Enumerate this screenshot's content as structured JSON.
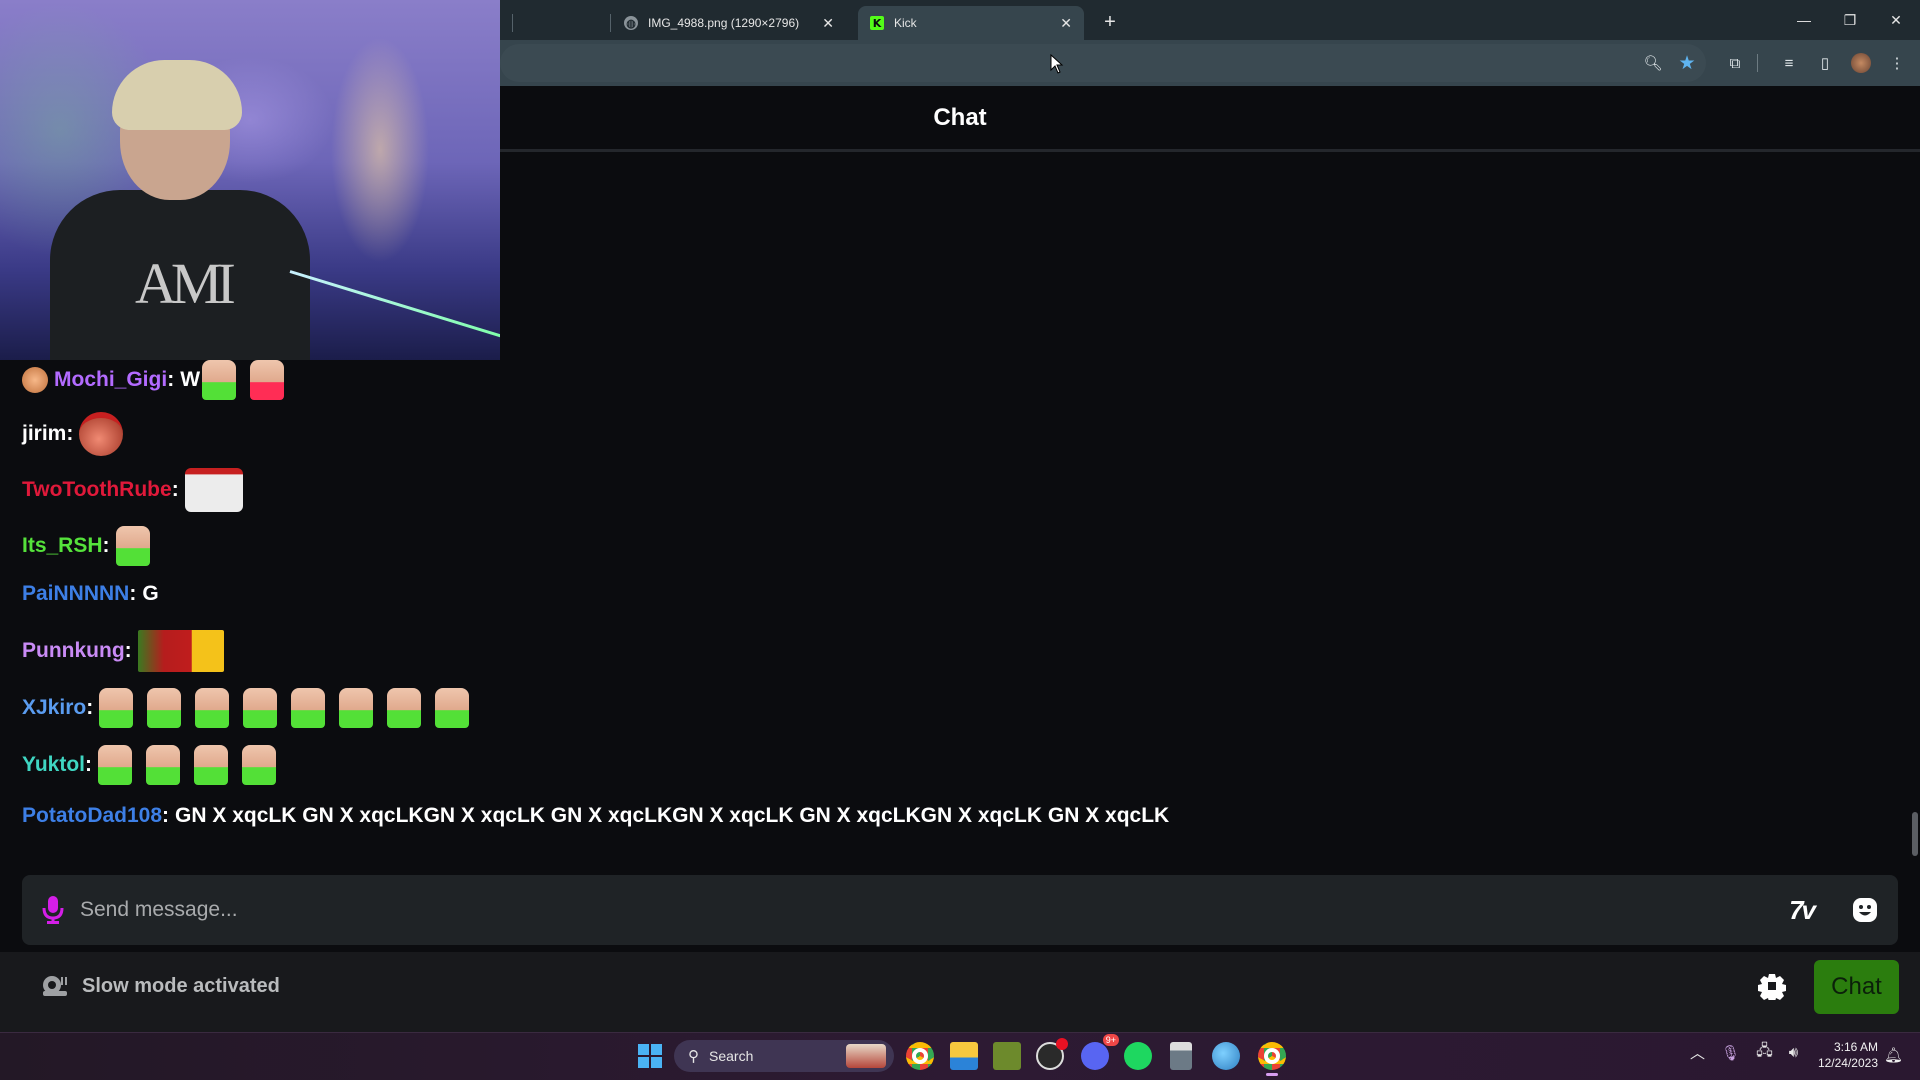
{
  "browser": {
    "tabs": [
      {
        "title": "IMG_4988.png (1290×2796)",
        "icon": "globe-icon",
        "active": false
      },
      {
        "title": "Kick",
        "icon": "kick-logo-icon",
        "active": true
      }
    ],
    "toolbar_icons": [
      "zoom-icon",
      "bookmark-star-icon",
      "extensions-icon",
      "media-control-icon",
      "side-panel-icon",
      "profile-avatar",
      "menu-icon"
    ],
    "accent_star": "#5fb4f0"
  },
  "chat": {
    "title": "Chat",
    "messages": [
      {
        "user": "Mochi_Gigi",
        "color": "#b36bff",
        "badge": true,
        "text": "W",
        "emotes": [
          "face-green",
          "face-red"
        ]
      },
      {
        "user": "jirim",
        "color": "#ffffff",
        "badge": false,
        "text": "",
        "emotes": [
          "round-santa"
        ]
      },
      {
        "user": "TwoToothRube",
        "color": "#e0193a",
        "badge": false,
        "text": "",
        "emotes": [
          "snowman-pray"
        ]
      },
      {
        "user": "Its_RSH",
        "color": "#55e23b",
        "badge": false,
        "text": "",
        "emotes": [
          "face-green"
        ]
      },
      {
        "user": "PaiNNNNN",
        "color": "#3d7fe6",
        "badge": false,
        "text": "G",
        "emotes": []
      },
      {
        "user": "Punnkung",
        "color": "#c98bf5",
        "badge": false,
        "text": "",
        "emotes": [
          "xmas-banner"
        ]
      },
      {
        "user": "XJkiro",
        "color": "#5a9cf0",
        "badge": false,
        "text": "",
        "emotes": [
          "face-green",
          "face-green",
          "face-green",
          "face-green",
          "face-green",
          "face-green",
          "face-green",
          "face-green"
        ]
      },
      {
        "user": "Yuktol",
        "color": "#3fd6c2",
        "badge": false,
        "text": "",
        "emotes": [
          "face-green",
          "face-green",
          "face-green",
          "face-green"
        ]
      },
      {
        "user": "PotatoDad108",
        "color": "#3d7fe6",
        "badge": false,
        "text": "GN X xqcLK GN X xqcLKGN X xqcLK GN X xqcLKGN X xqcLK GN X xqcLKGN X xqcLK GN X xqcLK",
        "emotes": []
      }
    ],
    "input": {
      "placeholder": "Send message...",
      "value": ""
    },
    "slow_mode_label": "Slow mode activated",
    "send_label": "Chat",
    "send_color": "#2b7d0e",
    "mic_color": "#d41ee8"
  },
  "taskbar": {
    "search_label": "Search",
    "apps": [
      "chrome",
      "file-explorer",
      "minecraft",
      "obs",
      "discord",
      "spotify",
      "calculator",
      "paint",
      "chrome"
    ],
    "discord_badge": "9+",
    "time": "3:16 AM",
    "date": "12/24/2023"
  }
}
